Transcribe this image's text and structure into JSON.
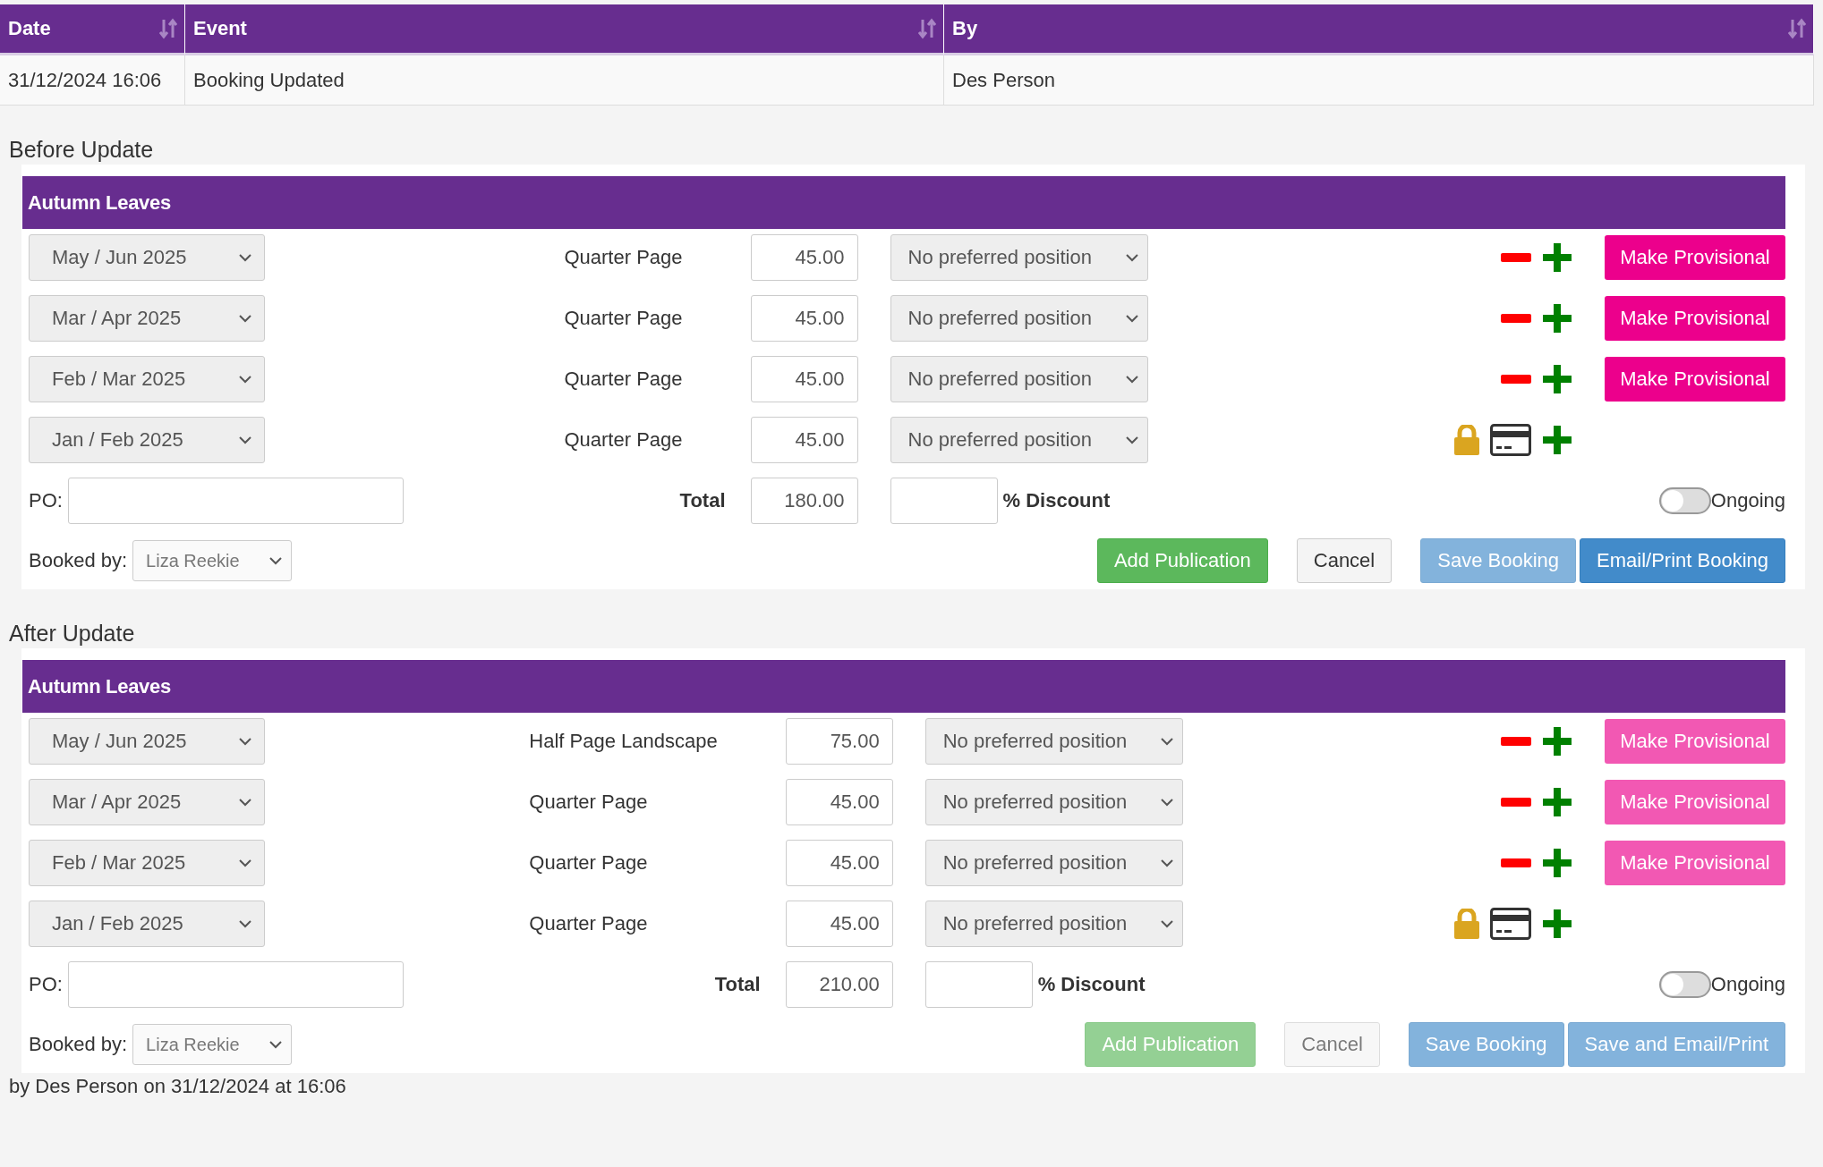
{
  "log_table": {
    "columns": [
      {
        "label": "Date"
      },
      {
        "label": "Event"
      },
      {
        "label": "By"
      }
    ],
    "rows": [
      [
        "31/12/2024 16:06",
        "Booking Updated",
        "Des Person"
      ]
    ]
  },
  "sections": [
    {
      "heading": "Before Update",
      "publication": "Autumn Leaves",
      "lines": [
        {
          "kind": "provisional",
          "issue": "May / Jun 2025",
          "size": "Quarter Page",
          "price": "45.00",
          "position": "No preferred position",
          "action": "Make Provisional",
          "disabled": false
        },
        {
          "kind": "provisional",
          "issue": "Mar / Apr 2025",
          "size": "Quarter Page",
          "price": "45.00",
          "position": "No preferred position",
          "action": "Make Provisional",
          "disabled": false
        },
        {
          "kind": "provisional",
          "issue": "Feb / Mar 2025",
          "size": "Quarter Page",
          "price": "45.00",
          "position": "No preferred position",
          "action": "Make Provisional",
          "disabled": false
        },
        {
          "kind": "locked",
          "issue": "Jan / Feb 2025",
          "size": "Quarter Page",
          "price": "45.00",
          "position": "No preferred position"
        }
      ],
      "po_label": "PO:",
      "total_label": "Total",
      "total": "180.00",
      "discount_label": "% Discount",
      "ongoing": {
        "label": "Ongoing",
        "on": false
      },
      "booked_by": {
        "label": "Booked by:",
        "value": "Liza Reekie"
      },
      "buttons": [
        {
          "label": "Add Publication",
          "kind": "success",
          "disabled": false
        },
        {
          "label": "Cancel",
          "kind": "default",
          "disabled": false
        },
        {
          "label": "Save Booking",
          "kind": "primary",
          "disabled": true
        },
        {
          "label": "Email/Print Booking",
          "kind": "primary",
          "disabled": false
        }
      ]
    },
    {
      "heading": "After Update",
      "publication": "Autumn Leaves",
      "lines": [
        {
          "kind": "provisional",
          "issue": "May / Jun 2025",
          "size": "Half Page Landscape",
          "price": "75.00",
          "position": "No preferred position",
          "action": "Make Provisional",
          "disabled": true
        },
        {
          "kind": "provisional",
          "issue": "Mar / Apr 2025",
          "size": "Quarter Page",
          "price": "45.00",
          "position": "No preferred position",
          "action": "Make Provisional",
          "disabled": true
        },
        {
          "kind": "provisional",
          "issue": "Feb / Mar 2025",
          "size": "Quarter Page",
          "price": "45.00",
          "position": "No preferred position",
          "action": "Make Provisional",
          "disabled": true
        },
        {
          "kind": "locked",
          "issue": "Jan / Feb 2025",
          "size": "Quarter Page",
          "price": "45.00",
          "position": "No preferred position"
        }
      ],
      "po_label": "PO:",
      "total_label": "Total",
      "total": "210.00",
      "discount_label": "% Discount",
      "ongoing": {
        "label": "Ongoing",
        "on": false
      },
      "booked_by": {
        "label": "Booked by:",
        "value": "Liza Reekie"
      },
      "buttons": [
        {
          "label": "Add Publication",
          "kind": "success",
          "disabled": true
        },
        {
          "label": "Cancel",
          "kind": "default",
          "disabled": true
        },
        {
          "label": "Save Booking",
          "kind": "primary",
          "disabled": true
        },
        {
          "label": "Save and Email/Print",
          "kind": "primary",
          "disabled": true
        }
      ]
    }
  ],
  "footer": "by Des Person on 31/12/2024 at 16:06"
}
